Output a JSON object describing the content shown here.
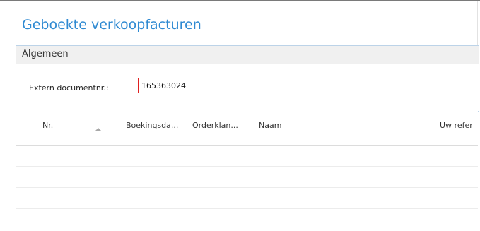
{
  "page": {
    "title": "Geboekte verkoopfacturen"
  },
  "filter_tab": {
    "title": "Algemeen",
    "field_label": "Extern documentnr.:",
    "field_value": "165363024"
  },
  "list": {
    "columns": [
      "Nr.",
      "Boekingsda...",
      "Orderklan...",
      "Naam",
      "Uw refer"
    ],
    "sort_direction": "ascending",
    "rows": []
  },
  "colors": {
    "title": "#2f8ad2",
    "validation_border": "#e02020",
    "fasttab_border": "#bcd3e8"
  }
}
